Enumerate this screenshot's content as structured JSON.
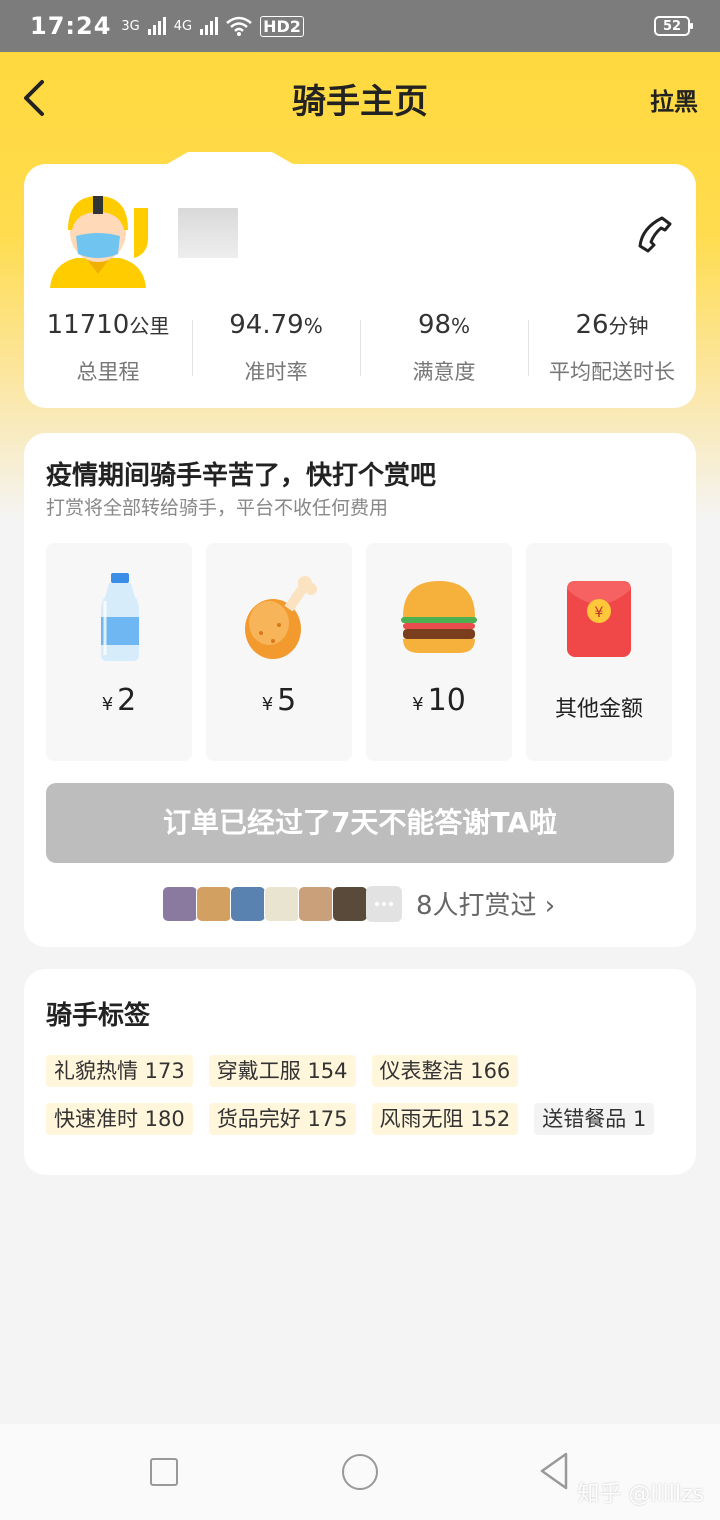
{
  "status_bar": {
    "time": "17:24",
    "network_1": "3G",
    "network_2": "4G",
    "hd": "HD2",
    "battery": "52"
  },
  "nav": {
    "title": "骑手主页",
    "block_label": "拉黑"
  },
  "rider": {
    "stats": [
      {
        "value": "11710",
        "unit": "公里",
        "label": "总里程"
      },
      {
        "value": "94.79",
        "unit": "%",
        "label": "准时率"
      },
      {
        "value": "98",
        "unit": "%",
        "label": "满意度"
      },
      {
        "value": "26",
        "unit": "分钟",
        "label": "平均配送时长"
      }
    ]
  },
  "tip": {
    "title": "疫情期间骑手辛苦了，快打个赏吧",
    "subtitle": "打赏将全部转给骑手，平台不收任何费用",
    "gifts": [
      {
        "currency": "¥",
        "amount": "2",
        "icon": "water-bottle-icon"
      },
      {
        "currency": "¥",
        "amount": "5",
        "icon": "chicken-leg-icon"
      },
      {
        "currency": "¥",
        "amount": "10",
        "icon": "burger-icon"
      },
      {
        "label": "其他金额",
        "icon": "red-envelope-icon"
      }
    ],
    "disabled_button": "订单已经过了7天不能答谢TA啦",
    "tippers_text": "8人打赏过 ›",
    "tipper_colors": [
      "#8a7aa0",
      "#d2a060",
      "#5a82b0",
      "#e8e4d0",
      "#c9a07a",
      "#5a4a3a"
    ]
  },
  "tags": {
    "title": "骑手标签",
    "items": [
      "礼貌热情 173",
      "穿戴工服 154",
      "仪表整洁 166",
      "快速准时 180",
      "货品完好 175",
      "风雨无阻 152",
      "送错餐品 1"
    ]
  },
  "watermark": "知乎 @lllllzs",
  "colors": {
    "brand_yellow": "#ffd83a",
    "disabled_gray": "#bdbdbd",
    "tag_bg": "#fff6dc"
  }
}
